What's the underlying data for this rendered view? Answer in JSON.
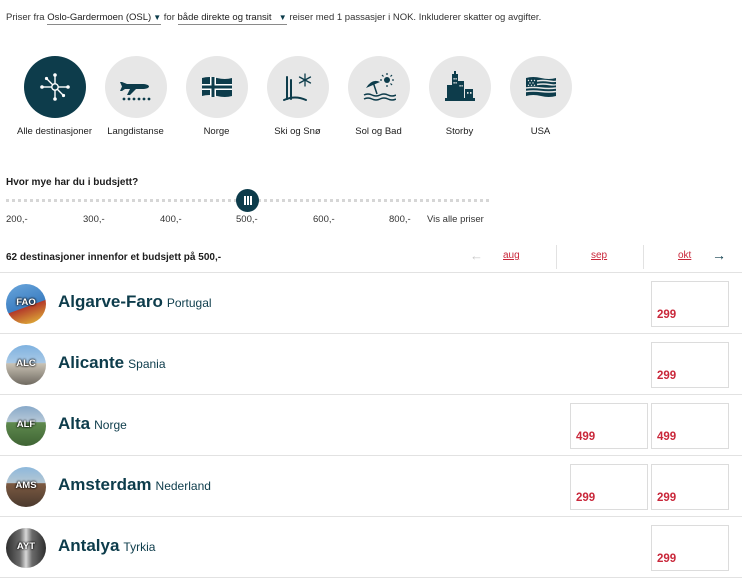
{
  "filters": {
    "prefix": "Priser fra",
    "origin": "Oslo-Gardermoen (OSL)",
    "mid": "for",
    "trip_type": "både direkte og transit",
    "suffix": "reiser med 1 passasjer i NOK. Inkluderer skatter og avgifter."
  },
  "categories": [
    {
      "label": "Alle destinasjoner",
      "icon": "network-icon",
      "active": true
    },
    {
      "label": "Langdistanse",
      "icon": "airplane-icon",
      "active": false
    },
    {
      "label": "Norge",
      "icon": "norway-flag-icon",
      "active": false
    },
    {
      "label": "Ski og Snø",
      "icon": "ski-snow-icon",
      "active": false
    },
    {
      "label": "Sol og Bad",
      "icon": "sun-beach-icon",
      "active": false
    },
    {
      "label": "Storby",
      "icon": "city-icon",
      "active": false
    },
    {
      "label": "USA",
      "icon": "usa-flag-icon",
      "active": false
    }
  ],
  "budget": {
    "question": "Hvor mye har du i budsjett?",
    "ticks": [
      "200,-",
      "300,-",
      "400,-",
      "500,-",
      "600,-",
      "800,-",
      "Vis alle priser"
    ],
    "selected": "500,-"
  },
  "results": {
    "count_text": "62 destinasjoner innenfor et budsjett på 500,-",
    "months": [
      "aug",
      "sep",
      "okt"
    ]
  },
  "colors": {
    "accent": "#0d3c4b",
    "price": "#c9273a"
  },
  "destinations": [
    {
      "code": "FAO",
      "city": "Algarve-Faro",
      "country": "Portugal",
      "sep": "",
      "okt": "299"
    },
    {
      "code": "ALC",
      "city": "Alicante",
      "country": "Spania",
      "sep": "",
      "okt": "299"
    },
    {
      "code": "ALF",
      "city": "Alta",
      "country": "Norge",
      "sep": "499",
      "okt": "499"
    },
    {
      "code": "AMS",
      "city": "Amsterdam",
      "country": "Nederland",
      "sep": "299",
      "okt": "299"
    },
    {
      "code": "AYT",
      "city": "Antalya",
      "country": "Tyrkia",
      "sep": "",
      "okt": "299"
    }
  ]
}
